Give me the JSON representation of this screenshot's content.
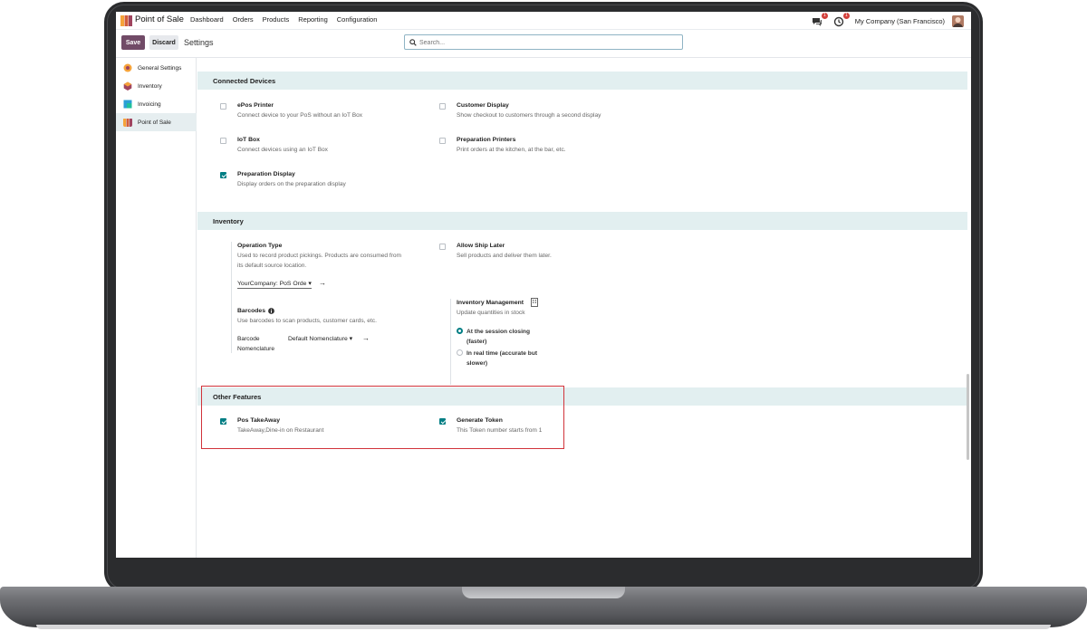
{
  "app": {
    "name": "Point of Sale"
  },
  "nav": {
    "menu": [
      "Dashboard",
      "Orders",
      "Products",
      "Reporting",
      "Configuration"
    ],
    "chat_badge": "1",
    "activity_badge": "1",
    "company": "My Company (San Francisco)"
  },
  "control": {
    "save": "Save",
    "discard": "Discard",
    "title": "Settings",
    "search_placeholder": "Search..."
  },
  "sidebar": {
    "items": [
      {
        "label": "General Settings",
        "color": "#f6a33a"
      },
      {
        "label": "Inventory",
        "color": "#a0445f"
      },
      {
        "label": "Invoicing",
        "color": "#2a9fd6"
      },
      {
        "label": "Point of Sale",
        "color": "#d35d3a"
      }
    ]
  },
  "sections": {
    "connected": {
      "title": "Connected Devices",
      "epos": {
        "title": "ePos Printer",
        "desc": "Connect device to your PoS without an IoT Box",
        "checked": false
      },
      "customer_display": {
        "title": "Customer Display",
        "desc": "Show checkout to customers through a second display",
        "checked": false
      },
      "iot": {
        "title": "IoT Box",
        "desc": "Connect devices using an IoT Box",
        "checked": false
      },
      "prep_printers": {
        "title": "Preparation Printers",
        "desc": "Print orders at the kitchen, at the bar, etc.",
        "checked": false
      },
      "prep_display": {
        "title": "Preparation Display",
        "desc": "Display orders on the preparation display",
        "checked": true
      }
    },
    "inventory": {
      "title": "Inventory",
      "operation_type": {
        "title": "Operation Type",
        "desc1": "Used to record product pickings. Products are consumed from",
        "desc2": "its default source location.",
        "value": "YourCompany: PoS Orde"
      },
      "ship_later": {
        "title": "Allow Ship Later",
        "desc": "Sell products and deliver them later.",
        "checked": false
      },
      "barcodes": {
        "title": "Barcodes",
        "desc": "Use barcodes to scan products, customer cards, etc.",
        "label1": "Barcode",
        "label2": "Nomenclature",
        "value": "Default Nomenclature"
      },
      "inv_mgmt": {
        "title": "Inventory Management",
        "desc": "Update quantities in stock",
        "opt1a": "At the session closing",
        "opt1b": "(faster)",
        "opt2a": "In real time (accurate but",
        "opt2b": "slower)"
      }
    },
    "other": {
      "title": "Other Features",
      "takeaway": {
        "title": "Pos TakeAway",
        "desc": "TakeAway,Dine-in on Restaurant",
        "checked": true
      },
      "token": {
        "title": "Generate Token",
        "desc": "This Token number starts from 1",
        "checked": true
      }
    }
  }
}
